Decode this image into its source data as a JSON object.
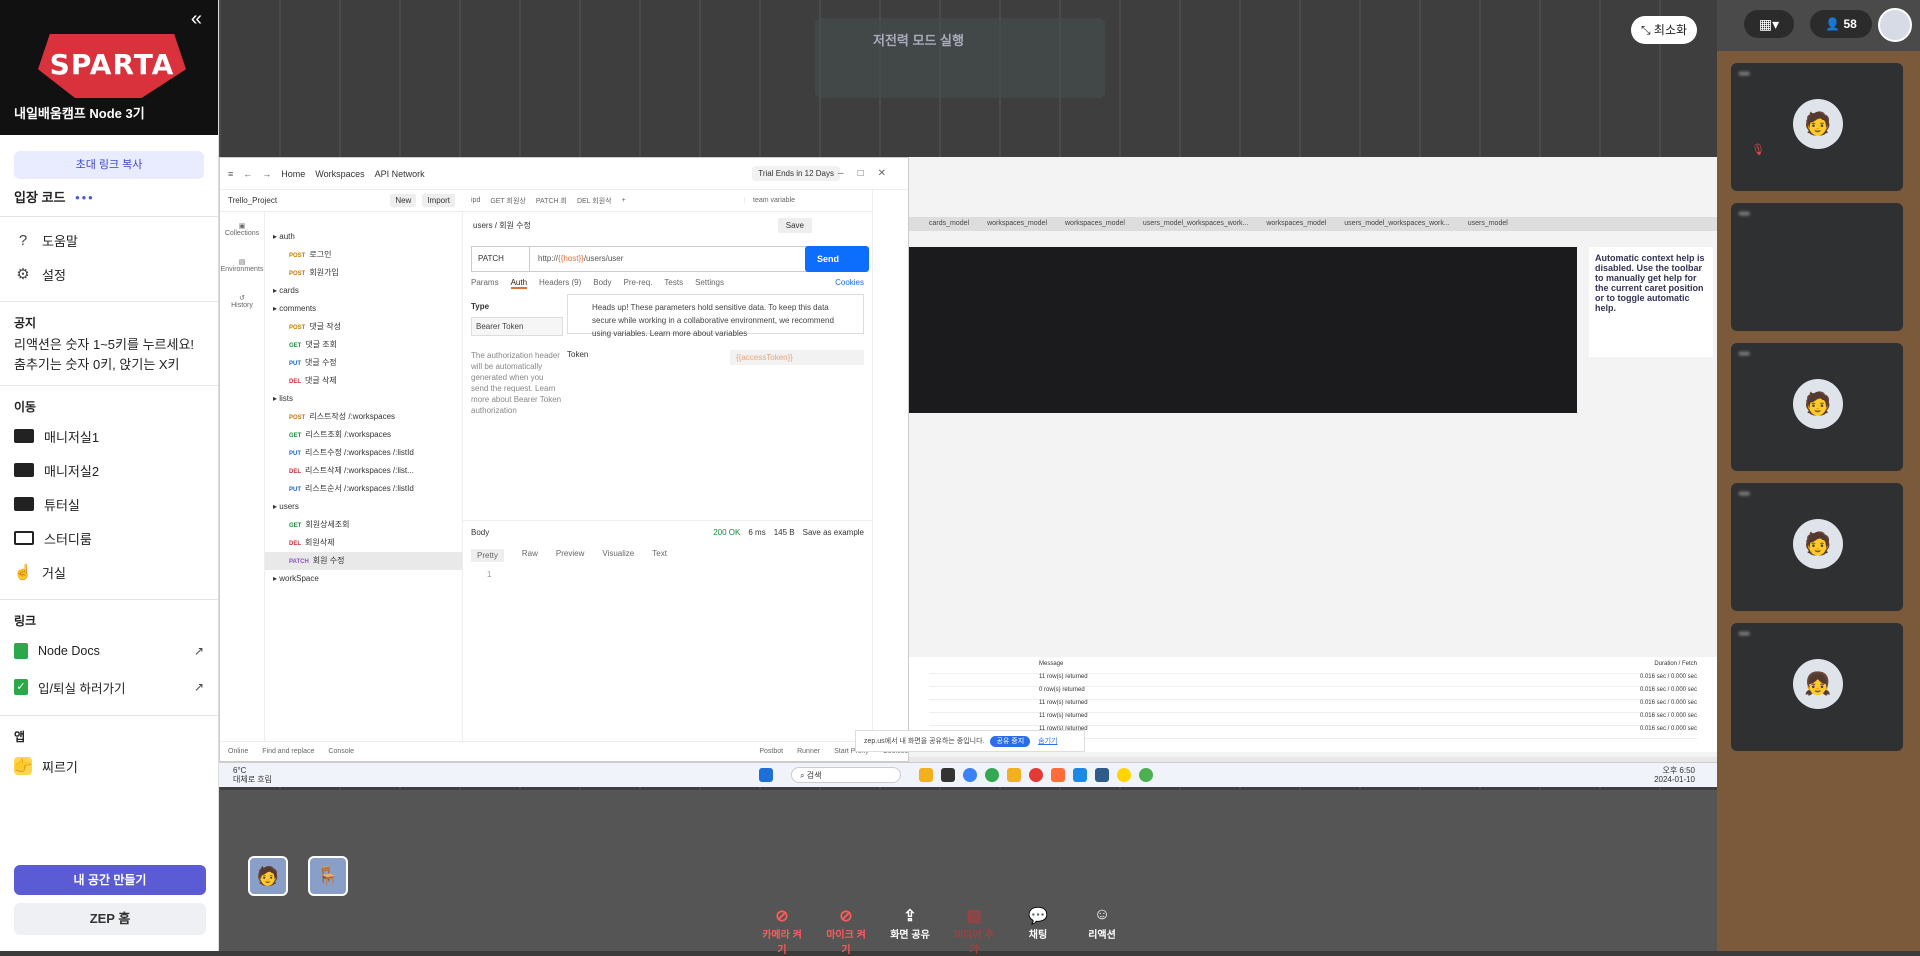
{
  "sidebar": {
    "space_name": "내일배움캠프 Node 3기",
    "logo_text": "SPARTA",
    "invite_button": "초대 링크 복사",
    "entry_label": "입장 코드",
    "entry_code": "•••",
    "menu": [
      {
        "label": "도움말",
        "icon": "help-icon"
      },
      {
        "label": "설정",
        "icon": "gear-icon"
      }
    ],
    "notice_title": "공지",
    "notice_lines": [
      "리액션은 숫자 1~5키를 누르세요!",
      "춤추기는 숫자 0키, 앉기는 X키"
    ],
    "move_title": "이동",
    "rooms": [
      "매니저실1",
      "매니저실2",
      "튜터실",
      "스터디룸",
      "거실"
    ],
    "links_title": "링크",
    "links": [
      {
        "label": "Node Docs",
        "color": "#2aa84a"
      },
      {
        "label": "입/퇴실 하러가기",
        "color": "#2aa84a"
      }
    ],
    "apps_title": "앱",
    "app_poke": "찌르기",
    "make_space": "내 공간 만들기",
    "zep_home": "ZEP 홈"
  },
  "game": {
    "power_toast_title": "저전력 모드 실행",
    "minimize": "최소화"
  },
  "top_right": {
    "user_count": "58"
  },
  "postman": {
    "nav": {
      "home": "Home",
      "workspaces": "Workspaces",
      "api_network": "API Network"
    },
    "trial": "Trial Ends in 12 Days",
    "workspace": "Trello_Project",
    "new_btn": "New",
    "import_btn": "Import",
    "sidebar_icons": [
      "Collections",
      "Environments",
      "History"
    ],
    "tree": [
      {
        "label": "auth",
        "type": "folder",
        "indent": 0
      },
      {
        "label": "로그인",
        "method": "POST",
        "indent": 1
      },
      {
        "label": "회원가입",
        "method": "POST",
        "indent": 1
      },
      {
        "label": "cards",
        "type": "folder",
        "indent": 0
      },
      {
        "label": "comments",
        "type": "folder",
        "indent": 0
      },
      {
        "label": "댓글 작성",
        "method": "POST",
        "indent": 1
      },
      {
        "label": "댓글 조회",
        "method": "GET",
        "indent": 1
      },
      {
        "label": "댓글 수정",
        "method": "PUT",
        "indent": 1
      },
      {
        "label": "댓글 삭제",
        "method": "DEL",
        "indent": 1
      },
      {
        "label": "lists",
        "type": "folder",
        "indent": 0
      },
      {
        "label": "리스트작성 /:workspaces",
        "method": "POST",
        "indent": 1
      },
      {
        "label": "리스트조회 /:workspaces",
        "method": "GET",
        "indent": 1
      },
      {
        "label": "리스트수정 /:workspaces /:listId",
        "method": "PUT",
        "indent": 1
      },
      {
        "label": "리스트삭제 /:workspaces /:list...",
        "method": "DEL",
        "indent": 1
      },
      {
        "label": "리스트순서 /:workspaces /:listId",
        "method": "PUT",
        "indent": 1
      },
      {
        "label": "users",
        "type": "folder",
        "indent": 0
      },
      {
        "label": "회원상세조회",
        "method": "GET",
        "indent": 1
      },
      {
        "label": "회원삭제",
        "method": "DEL",
        "indent": 1
      },
      {
        "label": "회원 수정",
        "method": "PATCH",
        "indent": 1,
        "selected": true
      },
      {
        "label": "workSpace",
        "type": "folder",
        "indent": 0
      }
    ],
    "tabs": [
      "ipd",
      "GET 회원상",
      "PATCH 회",
      "DEL 회원삭"
    ],
    "env": "team variable",
    "breadcrumb": "users / 회원 수정",
    "save": "Save",
    "method": "PATCH",
    "url_prefix": "http://",
    "url_var": "{{host}}",
    "url_suffix": "/users/user",
    "send": "Send",
    "subtabs": [
      "Params",
      "Auth",
      "Headers (9)",
      "Body",
      "Pre-req.",
      "Tests",
      "Settings"
    ],
    "cookies": "Cookies",
    "auth_type_label": "Type",
    "auth_type": "Bearer Token",
    "auth_help": "The authorization header will be automatically generated when you send the request. Learn more about Bearer Token authorization",
    "heads_up": "Heads up! These parameters hold sensitive data. To keep this data secure while working in a collaborative environment, we recommend using variables. Learn more about variables",
    "token_label": "Token",
    "token_value": "{{accessToken}}",
    "resp_body": "Body",
    "resp_status": "200 OK",
    "resp_time": "6 ms",
    "resp_size": "145 B",
    "save_example": "Save as example",
    "resp_tabs": [
      "Pretty",
      "Raw",
      "Preview",
      "Visualize"
    ],
    "resp_format": "Text",
    "line_number": "1",
    "footer": [
      "Online",
      "Find and replace",
      "Console",
      "Postbot",
      "Runner",
      "Start Proxy",
      "Cookies"
    ]
  },
  "db": {
    "tabs": [
      "cards_model",
      "workspaces_model",
      "workspaces_model",
      "users_model_workspaces_work...",
      "workspaces_model",
      "users_model_workspaces_work...",
      "users_model"
    ],
    "help_text": "Automatic context help is disabled. Use the toolbar to manually get help for the current caret position or to toggle automatic help.",
    "results": [
      {
        "msg": "11 row(s) returned",
        "dur": "0.016 sec / 0.000 sec"
      },
      {
        "msg": "0 row(s) returned",
        "dur": "0.016 sec / 0.000 sec"
      },
      {
        "msg": "11 row(s) returned",
        "dur": "0.016 sec / 0.000 sec"
      },
      {
        "msg": "11 row(s) returned",
        "dur": "0.016 sec / 0.000 sec"
      },
      {
        "msg": "11 row(s) returned",
        "dur": "0.016 sec / 0.000 sec"
      }
    ],
    "result_headers": [
      "Message",
      "Duration / Fetch"
    ]
  },
  "share_notice": {
    "text": "zep.us에서 내 화면을 공유하는 중입니다.",
    "stop": "공유 중지",
    "hide": "숨기기"
  },
  "taskbar": {
    "temp": "6°C",
    "weather": "대체로 흐림",
    "search": "검색",
    "time": "오후 6:50",
    "date": "2024-01-10"
  },
  "controls": [
    {
      "label": "카메라 켜기",
      "icon": "camera-off-icon",
      "style": "red"
    },
    {
      "label": "마이크 켜기",
      "icon": "mic-off-icon",
      "style": "red"
    },
    {
      "label": "화면 공유",
      "icon": "screen-share-icon",
      "style": "normal"
    },
    {
      "label": "미디어 추가",
      "icon": "media-icon",
      "style": "dim"
    },
    {
      "label": "채팅",
      "icon": "chat-icon",
      "style": "normal"
    },
    {
      "label": "리액션",
      "icon": "reaction-icon",
      "style": "normal"
    }
  ]
}
